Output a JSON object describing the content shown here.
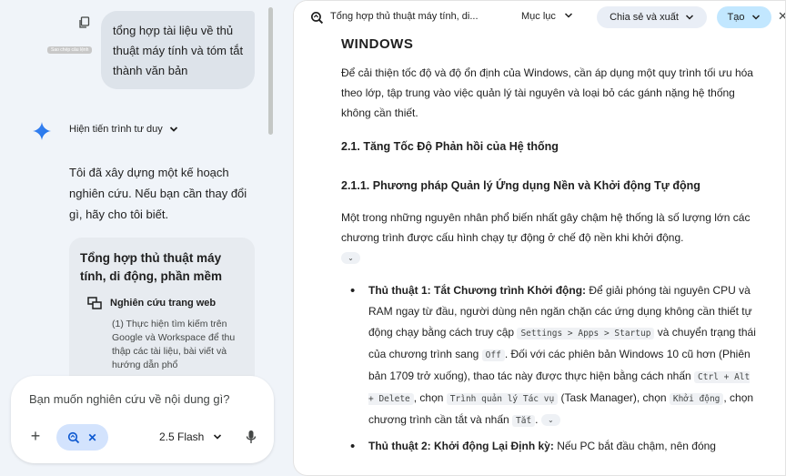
{
  "chat": {
    "user_message": "tổng hợp tài liệu về thủ thuật máy tính và tóm tắt thành văn bản",
    "copy_tooltip": "Sao chép câu lệnh",
    "show_process_label": "Hiện tiến trình tư duy",
    "intro_text": "Tôi đã xây dựng một kế hoạch nghiên cứu. Nếu bạn cần thay đổi gì, hãy cho tôi biết.",
    "plan": {
      "title": "Tổng hợp thủ thuật máy tính, di động, phần mềm",
      "step_title": "Nghiên cứu trang web",
      "step_desc": "(1) Thực hiện tìm kiếm trên Google và Workspace để thu thập các tài liệu, bài viết và hướng dẫn phổ"
    },
    "input_placeholder": "Bạn muốn nghiên cứu về nội dung gì?",
    "model_label": "2.5 Flash"
  },
  "doc": {
    "title": "Tổng hợp thủ thuật máy tính, di...",
    "toc_label": "Mục lục",
    "share_label": "Chia sẻ và xuất",
    "create_label": "Tạo",
    "heading_windows": "WINDOWS",
    "para1": "Để cải thiện tốc độ và độ ổn định của Windows, cần áp dụng một quy trình tối ưu hóa theo lớp, tập trung vào việc quản lý tài nguyên và loại bỏ các gánh nặng hệ thống không cần thiết.",
    "h2": "2.1. Tăng Tốc Độ Phản hồi của Hệ thống",
    "h3": "2.1.1. Phương pháp Quản lý Ứng dụng Nền và Khởi động Tự động",
    "para2": "Một trong những nguyên nhân phổ biến nhất gây chậm hệ thống là số lượng lớn các chương trình được cấu hình chạy tự động ở chế độ nền khi khởi động.",
    "tip1": {
      "title": "Thủ thuật 1: Tắt Chương trình Khởi động:",
      "t1": " Để giải phóng tài nguyên CPU và RAM ngay từ đầu, người dùng nên ngăn chặn các ứng dụng không cần thiết tự động chạy bằng cách truy cập ",
      "c1": "Settings > Apps > Startup",
      "t2": " và chuyển trạng thái của chương trình sang ",
      "c2": "Off",
      "t3": ". Đối với các phiên bản Windows 10 cũ hơn (Phiên bản 1709 trở xuống), thao tác này được thực hiện bằng cách nhấn ",
      "c3": "Ctrl + Alt + Delete",
      "t4": ", chọn ",
      "c4": "Trình quản lý Tác vụ",
      "t5": " (Task Manager), chọn ",
      "c5": "Khởi động",
      "t6": ", chọn chương trình cần tắt và nhấn ",
      "c6": "Tắt",
      "t7": "."
    },
    "tip2": {
      "title": "Thủ thuật 2: Khởi động Lại Định kỳ:",
      "t1": " Nếu PC bắt đầu chậm, nên đóng"
    }
  },
  "colors": {
    "accent": "#0b57d0",
    "chip_bg": "#d3e3fd",
    "create_bg": "#c2e7ff"
  },
  "icons": [
    "copy-icon",
    "gemini-star-icon",
    "chevron-down-icon",
    "web-research-icon",
    "plus-icon",
    "deep-research-icon",
    "close-icon",
    "mic-icon"
  ]
}
